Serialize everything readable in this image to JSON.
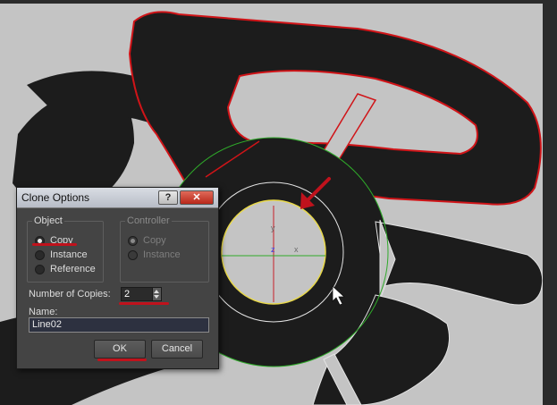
{
  "dialog": {
    "title": "Clone Options",
    "help_glyph": "?",
    "close_glyph": "✕",
    "object_group": {
      "title": "Object",
      "options": [
        {
          "label": "Copy",
          "checked": true
        },
        {
          "label": "Instance",
          "checked": false
        },
        {
          "label": "Reference",
          "checked": false
        }
      ]
    },
    "controller_group": {
      "title": "Controller",
      "options": [
        {
          "label": "Copy",
          "checked": true
        },
        {
          "label": "Instance",
          "checked": false
        }
      ]
    },
    "copies_label": "Number of Copies:",
    "copies_value": "2",
    "name_label": "Name:",
    "name_value": "Line02",
    "ok_label": "OK",
    "cancel_label": "Cancel"
  },
  "viewport": {
    "axis_labels": {
      "y": "y",
      "z": "z",
      "x": "x"
    },
    "colors": {
      "background": "#c4c4c4",
      "shape_fill": "#1c1c1c",
      "outline_red": "#d01418",
      "circle_green": "#2faa2a",
      "circle_yellow": "#e8d84a",
      "axis_red": "#c8202a",
      "axis_blue": "#3a3ae0",
      "annotation_red": "#c0121c"
    }
  }
}
